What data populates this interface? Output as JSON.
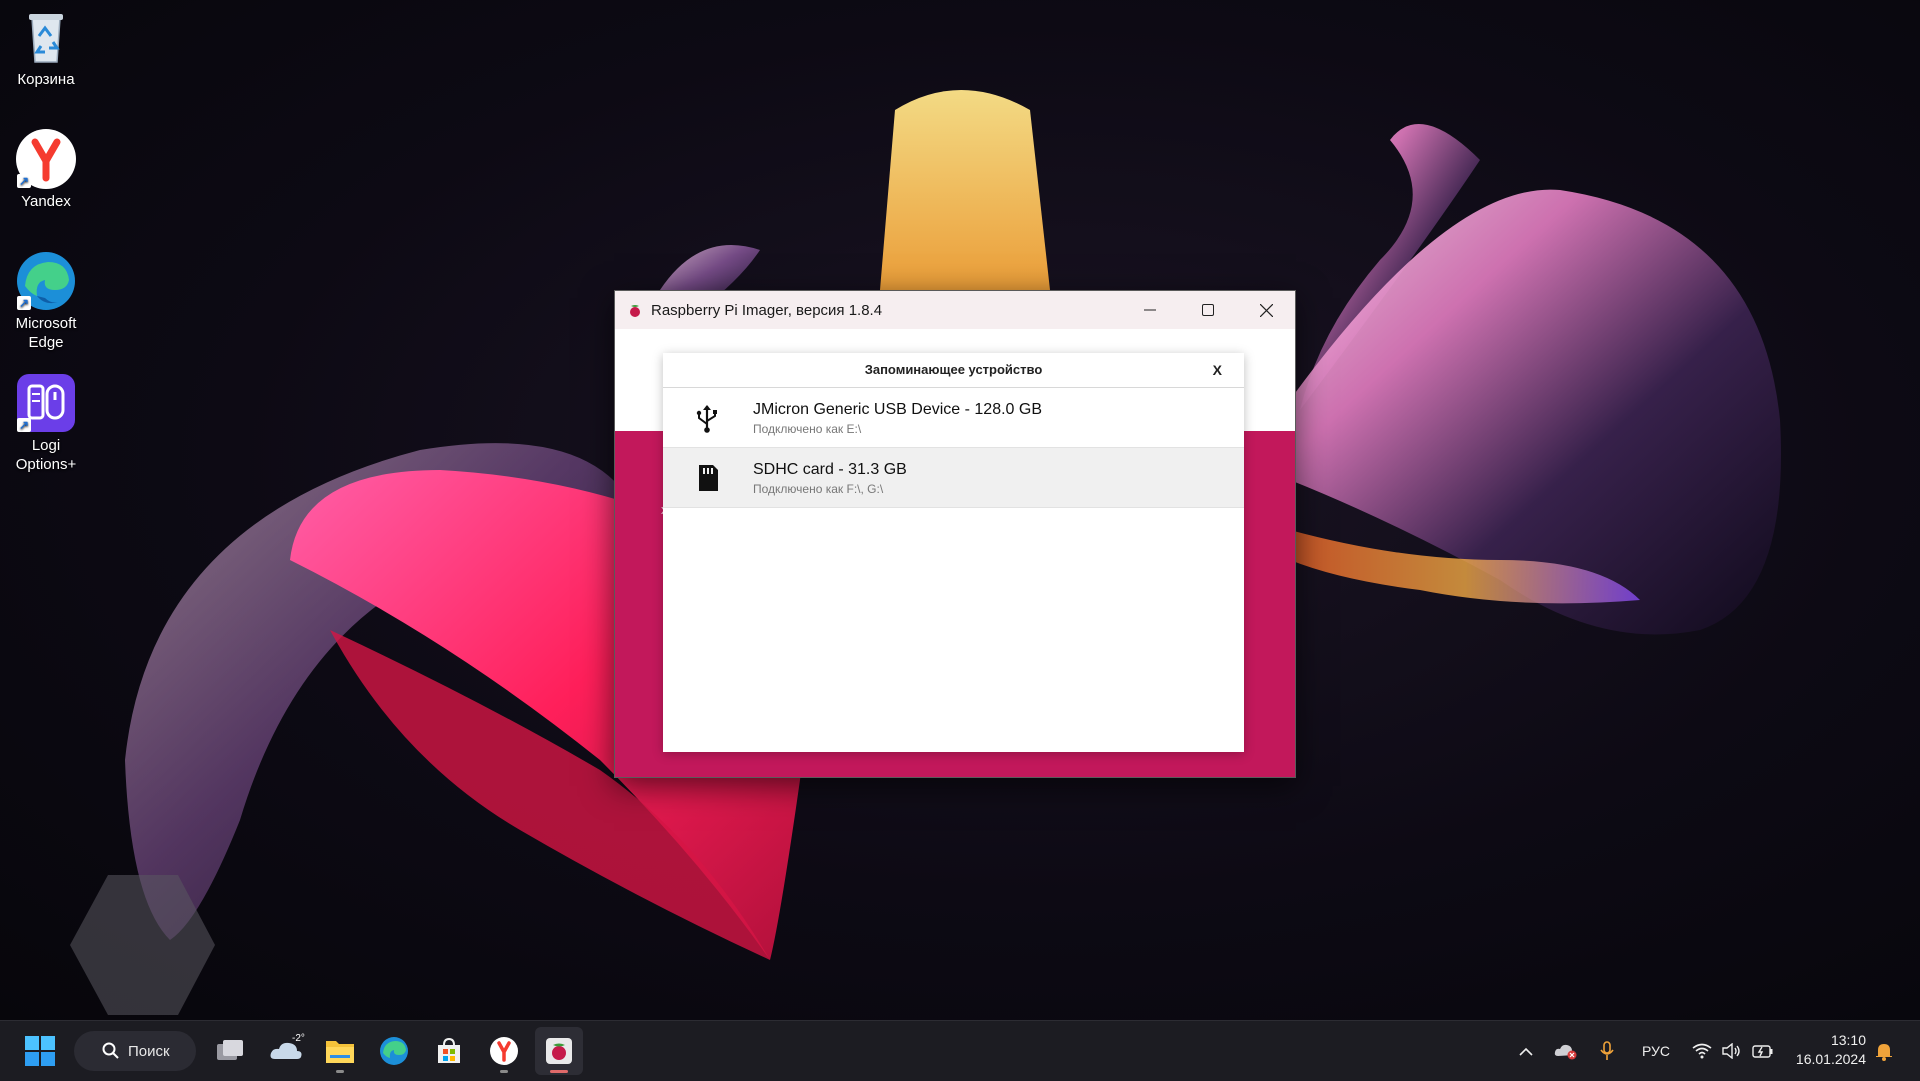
{
  "desktop": {
    "icons": [
      {
        "label": "Корзина"
      },
      {
        "label": "Yandex"
      },
      {
        "label": "Microsoft Edge"
      },
      {
        "label": "Logi Options+"
      }
    ]
  },
  "window": {
    "title": "Raspberry Pi Imager, версия 1.8.4",
    "background_color": "#c2185b",
    "stub_char": "Е",
    "stub_char2": "x"
  },
  "dialog": {
    "title": "Запоминающее устройство",
    "close_label": "X",
    "devices": [
      {
        "name": "JMicron Generic USB Device - 128.0 GB",
        "sub": "Подключено как E:\\",
        "icon": "usb-icon",
        "selected": false
      },
      {
        "name": "SDHC card - 31.3 GB",
        "sub": "Подключено как F:\\, G:\\",
        "icon": "sd-card-icon",
        "selected": true
      }
    ]
  },
  "taskbar": {
    "search_label": "Поиск",
    "weather_temp": "-2°",
    "language": "РУС",
    "time": "13:10",
    "date": "16.01.2024",
    "accent_color": "#e06a6a"
  }
}
